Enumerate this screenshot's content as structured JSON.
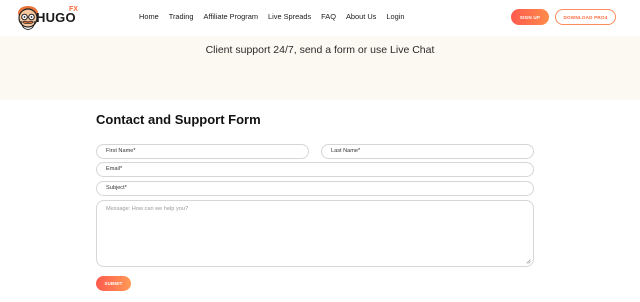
{
  "header": {
    "brand": "HUGO",
    "brand_sub": "FX",
    "nav": [
      "Home",
      "Trading",
      "Affiliate Program",
      "Live Spreads",
      "FAQ",
      "About Us",
      "Login"
    ],
    "signup_label": "SIGN UP",
    "download_label": "DOWNLOAD PRO4"
  },
  "banner": {
    "text": "Client support 24/7, send a form or use Live Chat"
  },
  "form": {
    "title": "Contact and Support Form",
    "first_name": "First Name*",
    "last_name": "Last Name*",
    "email": "Email*",
    "subject": "Subject*",
    "message_placeholder": "Message: How can we help you?",
    "submit_label": "SUBMIT"
  },
  "colors": {
    "accent": "#ff6a3d",
    "accent_gradient_start": "#ff5a4e",
    "accent_gradient_end": "#ff8c4a",
    "banner_bg": "#fcf9f2"
  }
}
